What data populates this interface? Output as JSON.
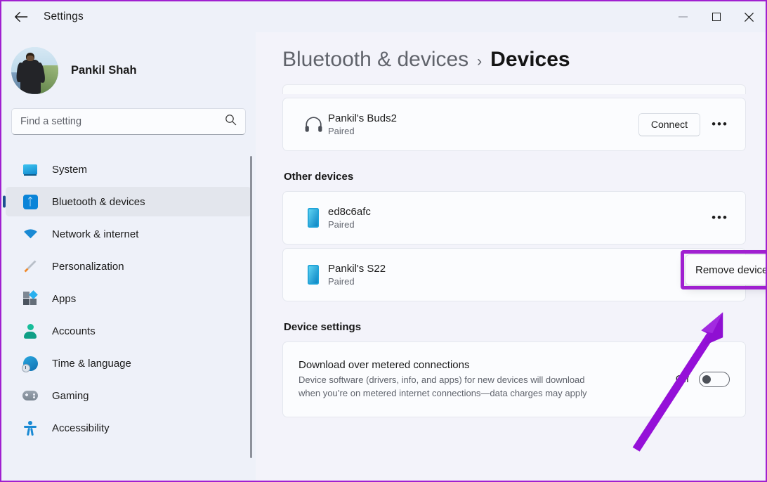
{
  "window": {
    "title": "Settings",
    "back_icon": "back-arrow-icon",
    "minimize_label": "Minimize",
    "maximize_label": "Maximize",
    "close_label": "Close"
  },
  "accent_colors": {
    "annotation_purple": "#A020D0",
    "selection_bar": "#1D4F91",
    "bluetooth_blue": "#0A84D8",
    "page_background": "#F3F3FA",
    "sidebar_background": "#EEF1F9",
    "card_background": "#FBFCFE"
  },
  "sidebar": {
    "profile": {
      "name": "Pankil Shah",
      "avatar_icon": "user-avatar"
    },
    "search": {
      "placeholder": "Find a setting",
      "value": "",
      "icon": "search-icon"
    },
    "items": [
      {
        "label": "System",
        "icon": "monitor-icon",
        "active": false
      },
      {
        "label": "Bluetooth & devices",
        "icon": "bluetooth-icon",
        "active": true
      },
      {
        "label": "Network & internet",
        "icon": "wifi-icon",
        "active": false
      },
      {
        "label": "Personalization",
        "icon": "paintbrush-icon",
        "active": false
      },
      {
        "label": "Apps",
        "icon": "apps-icon",
        "active": false
      },
      {
        "label": "Accounts",
        "icon": "person-icon",
        "active": false
      },
      {
        "label": "Time & language",
        "icon": "clock-globe-icon",
        "active": false
      },
      {
        "label": "Gaming",
        "icon": "gamepad-icon",
        "active": false
      },
      {
        "label": "Accessibility",
        "icon": "accessibility-icon",
        "active": false
      }
    ]
  },
  "main": {
    "breadcrumb": {
      "parent": "Bluetooth & devices",
      "separator": "›",
      "current": "Devices"
    },
    "top_device": {
      "name": "Pankil's Buds2",
      "status": "Paired",
      "icon": "headphones-icon",
      "connect_label": "Connect",
      "more_label": "•••"
    },
    "other_devices": {
      "heading": "Other devices",
      "devices": [
        {
          "name": "ed8c6afc",
          "status": "Paired",
          "icon": "phone-icon",
          "more_label": "•••"
        },
        {
          "name": "Pankil's S22",
          "status": "Paired",
          "icon": "phone-icon",
          "more_label": "•••"
        }
      ]
    },
    "device_settings": {
      "heading": "Device settings",
      "metered": {
        "title": "Download over metered connections",
        "description": "Device software (drivers, info, and apps) for new devices will download when you’re on metered internet connections—data charges may apply",
        "toggle_state": "Off"
      }
    }
  },
  "annotation": {
    "context_menu_item": "Remove device",
    "highlight_color": "#A020D0",
    "arrow_icon": "pointer-arrow-icon"
  }
}
